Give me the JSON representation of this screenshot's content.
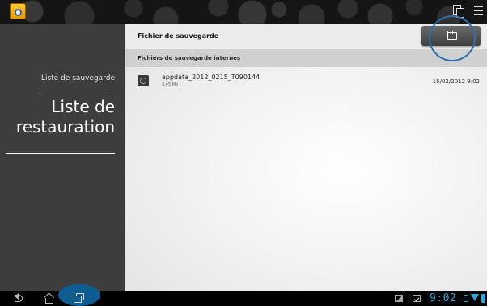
{
  "action_bar": {
    "app_icon": "backup-app-icon",
    "icons": [
      "copy-icon",
      "menu-icon"
    ]
  },
  "sidebar": {
    "items": [
      {
        "label": "Liste de sauvegarde",
        "active": false
      },
      {
        "label": "Liste de restauration",
        "active": true
      }
    ]
  },
  "main": {
    "header_title": "Fichier de sauvegarde",
    "folder_button_icon": "folder-icon",
    "section_title": "Fichiers de sauvegarde internes",
    "files": [
      {
        "icon": "backup-file-icon",
        "name": "appdata_2012_0215_T090144",
        "size": "3,45 Mo",
        "date": "15/02/2012 9:02"
      }
    ]
  },
  "system_bar": {
    "nav_icons": [
      "back-icon",
      "home-icon",
      "recents-icon"
    ],
    "status_icons": [
      "image-notification-icon",
      "checkbox-notification-icon",
      "bluetooth-icon",
      "wifi-icon",
      "battery-icon"
    ],
    "time": "9:02"
  },
  "colors": {
    "accent": "#29a8e0",
    "highlight_circle": "#2a6fb0",
    "sidebar_bg": "#3d3d3d",
    "recents_highlight": "#0e5d92"
  }
}
